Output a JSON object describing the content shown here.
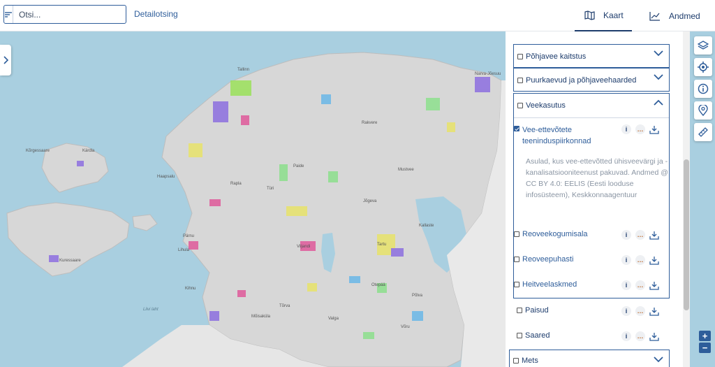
{
  "header": {
    "search_placeholder": "Otsi...",
    "detail_search_label": "Detailotsing",
    "tab_map_label": "Kaart",
    "tab_data_label": "Andmed"
  },
  "map": {
    "place_labels": [
      "Kärdla",
      "Kõrgessaare",
      "Haapsalu",
      "Pärnu",
      "Rapla",
      "Paide",
      "Türi",
      "Viljandi",
      "Tartu",
      "Otepää",
      "Valga",
      "Võru",
      "Põlva",
      "Jõgeva",
      "Rakvere",
      "Kuressaare",
      "Lihula",
      "Kihnu",
      "Mustvee",
      "Narva-Jõesuu",
      "Tallinn",
      "Kallaste",
      "Tõrva",
      "Mõisaküla"
    ],
    "sea_labels": [
      "Liivi laht"
    ]
  },
  "panel": {
    "groups": [
      {
        "label": "Põhjavee kaitstus",
        "checked": false,
        "expanded": false
      },
      {
        "label": "Puurkaevud ja põhjaveehaarded",
        "checked": false,
        "expanded": false
      },
      {
        "label": "Veekasutus",
        "checked": false,
        "expanded": true
      }
    ],
    "veekasutus_layers": [
      {
        "label": "Vee-ettevõtete teeninduspiirkonnad",
        "checked": true
      },
      {
        "label": "Reoveekogumisala",
        "checked": false
      },
      {
        "label": "Reoveepuhasti",
        "checked": false
      },
      {
        "label": "Heitveelaskmed",
        "checked": false
      }
    ],
    "layer_description": "Asulad, kus vee-ettevõtted ühisveevärgi ja -kanalisatsiooniteenust pakuvad. Andmed @ CC BY 4.0: EELIS (Eesti looduse infosüsteem), Keskkonnaagentuur",
    "other_layers": [
      {
        "label": "Paisud",
        "checked": false
      },
      {
        "label": "Saared",
        "checked": false
      }
    ],
    "bottom_group": {
      "label": "Mets",
      "checked": false
    }
  },
  "tools": [
    "layers-icon",
    "locate-icon",
    "info-icon",
    "pin-icon",
    "ruler-icon"
  ],
  "zoom": {
    "in_label": "+",
    "out_label": "−"
  },
  "colors": {
    "accent": "#2e5d9a",
    "sea": "#a9cfe0",
    "land": "#d7d7d7"
  }
}
